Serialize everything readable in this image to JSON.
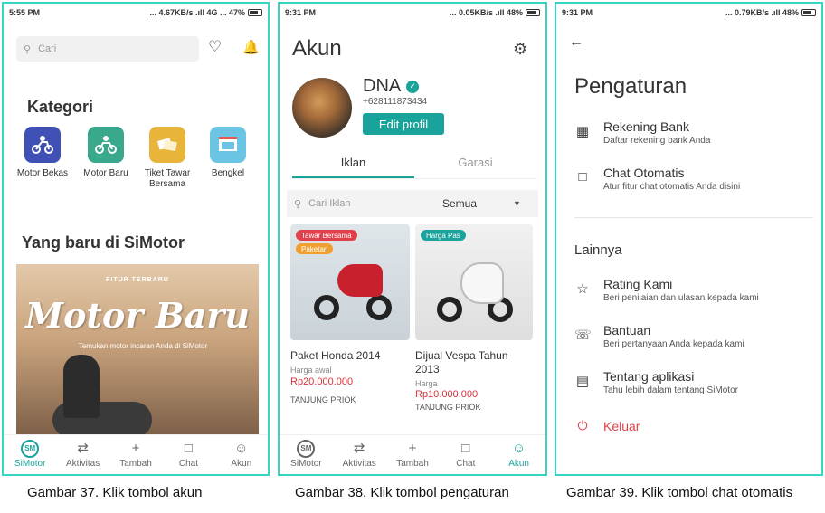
{
  "screen1": {
    "status": {
      "time": "5:55 PM",
      "right": "... 4.67KB/s .ıll 4G ... 47%"
    },
    "search_placeholder": "Cari",
    "kategori_title": "Kategori",
    "categories": [
      {
        "label": "Motor Bekas",
        "color": "#3f51b5"
      },
      {
        "label": "Motor Baru",
        "color": "#3aa88c"
      },
      {
        "label": "Tiket Tawar Bersama",
        "color": "#e8b53a"
      },
      {
        "label": "Bengkel",
        "color": "#6cc4e4"
      }
    ],
    "new_title": "Yang baru di SiMotor",
    "banner": {
      "small": "FITUR TERBARU",
      "big": "Motor Baru",
      "sub": "Temukan motor incaran Anda di SiMotor"
    },
    "nav": [
      "SiMotor",
      "Aktivitas",
      "Tambah",
      "Chat",
      "Akun"
    ]
  },
  "screen2": {
    "status": {
      "time": "9:31 PM",
      "right": "... 0.05KB/s .ıll 48%"
    },
    "title": "Akun",
    "name": "DNA",
    "phone": "+628111873434",
    "edit_label": "Edit profil",
    "tabs": [
      "Iklan",
      "Garasi"
    ],
    "filter_placeholder": "Cari Iklan",
    "filter_select": "Semua",
    "cards": [
      {
        "tags": [
          "Tawar Bersama",
          "Paketan"
        ],
        "title": "Paket Honda 2014",
        "sub": "Harga awal",
        "price": "Rp20.000.000",
        "loc": "TANJUNG PRIOK"
      },
      {
        "tags": [
          "Harga Pas"
        ],
        "title": "Dijual Vespa Tahun 2013",
        "sub": "Harga",
        "price": "Rp10.000.000",
        "loc": "TANJUNG PRIOK"
      }
    ],
    "nav": [
      "SiMotor",
      "Aktivitas",
      "Tambah",
      "Chat",
      "Akun"
    ]
  },
  "screen3": {
    "status": {
      "time": "9:31 PM",
      "right": "... 0.79KB/s .ıll 48%"
    },
    "title": "Pengaturan",
    "items": [
      {
        "title": "Rekening Bank",
        "sub": "Daftar rekening bank Anda"
      },
      {
        "title": "Chat Otomatis",
        "sub": "Atur fitur chat otomatis Anda disini"
      }
    ],
    "section": "Lainnya",
    "others": [
      {
        "title": "Rating Kami",
        "sub": "Beri penilaian dan ulasan kepada kami"
      },
      {
        "title": "Bantuan",
        "sub": "Beri pertanyaan Anda kepada kami"
      },
      {
        "title": "Tentang aplikasi",
        "sub": "Tahu lebih dalam tentang SiMotor"
      }
    ],
    "logout": "Keluar"
  },
  "captions": [
    "Gambar 37. Klik tombol akun",
    "Gambar 38. Klik tombol pengaturan",
    "Gambar 39. Klik tombol chat otomatis"
  ]
}
